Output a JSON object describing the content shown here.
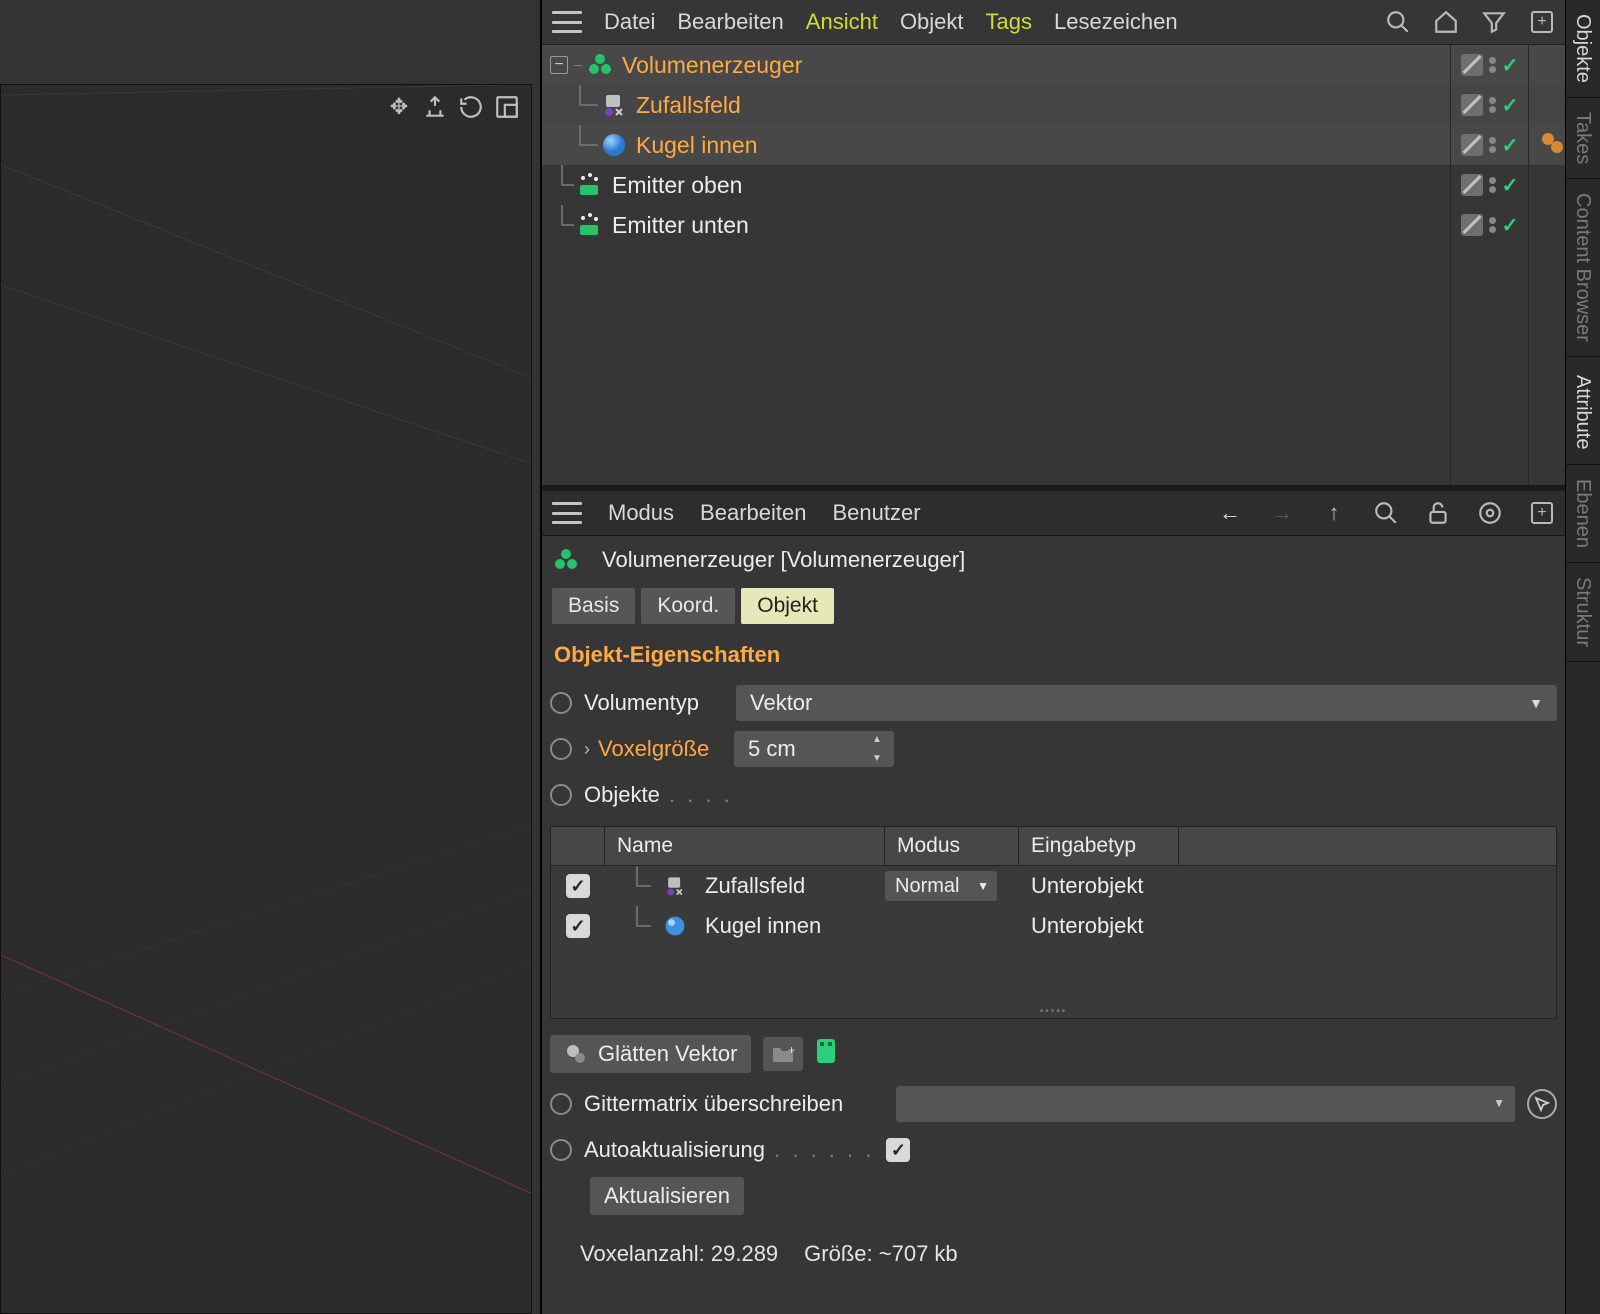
{
  "object_manager": {
    "menu": {
      "datei": "Datei",
      "bearbeiten": "Bearbeiten",
      "ansicht": "Ansicht",
      "objekt": "Objekt",
      "tags": "Tags",
      "lesezeichen": "Lesezeichen"
    },
    "tree": [
      {
        "name": "Volumenerzeuger",
        "icon": "volume",
        "selected": true,
        "indent": 0,
        "expander": "-",
        "tags": []
      },
      {
        "name": "Zufallsfeld",
        "icon": "random-field",
        "selected": true,
        "indent": 1,
        "tags": []
      },
      {
        "name": "Kugel innen",
        "icon": "sphere",
        "selected": true,
        "indent": 1,
        "tags": [
          "dynamics"
        ]
      },
      {
        "name": "Emitter oben",
        "icon": "emitter",
        "selected": false,
        "indent": 0,
        "tags": []
      },
      {
        "name": "Emitter unten",
        "icon": "emitter",
        "selected": false,
        "indent": 0,
        "tags": []
      }
    ]
  },
  "attribute_manager": {
    "menu": {
      "modus": "Modus",
      "bearbeiten": "Bearbeiten",
      "benutzer": "Benutzer"
    },
    "header": "Volumenerzeuger [Volumenerzeuger]",
    "tabs": {
      "basis": "Basis",
      "koord": "Koord.",
      "objekt": "Objekt"
    },
    "section": "Objekt-Eigenschaften",
    "props": {
      "volumentyp_label": "Volumentyp",
      "volumentyp_value": "Vektor",
      "voxelgroesse_label": "Voxelgröße",
      "voxelgroesse_value": "5 cm",
      "objekte_label": "Objekte"
    },
    "obj_list": {
      "headers": {
        "name": "Name",
        "modus": "Modus",
        "eingabetyp": "Eingabetyp"
      },
      "rows": [
        {
          "name": "Zufallsfeld",
          "icon": "random-field",
          "mode": "Normal",
          "input": "Unterobjekt",
          "checked": true
        },
        {
          "name": "Kugel innen",
          "icon": "sphere",
          "mode": "",
          "input": "Unterobjekt",
          "checked": true
        }
      ]
    },
    "glaetten": "Glätten Vektor",
    "gittermatrix": "Gittermatrix überschreiben",
    "autoaktualisierung": "Autoaktualisierung",
    "aktualisieren": "Aktualisieren",
    "status": {
      "voxel": "Voxelanzahl: 29.289",
      "size": "Größe: ~707 kb"
    }
  },
  "side_tabs": {
    "objekte": "Objekte",
    "takes": "Takes",
    "content": "Content Browser",
    "attribute": "Attribute",
    "ebenen": "Ebenen",
    "struktur": "Struktur"
  }
}
